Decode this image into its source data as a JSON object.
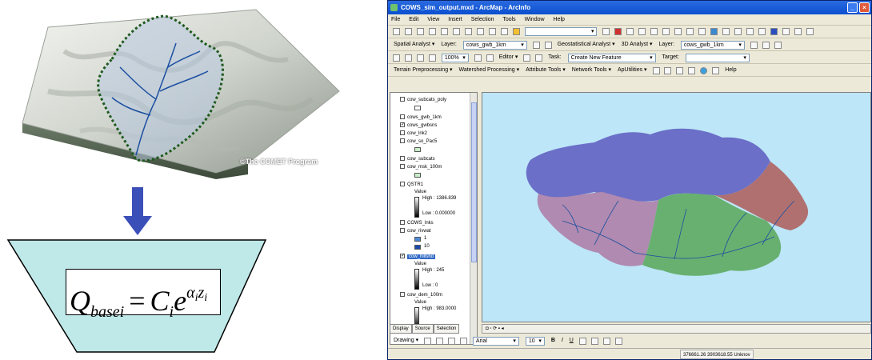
{
  "left_figure": {
    "credit": "©The COMET Program",
    "formula": {
      "q": "Q",
      "q_sub": "basei",
      "equals": "=",
      "c": "C",
      "c_sub": "i",
      "e": "e",
      "alpha": "α",
      "alpha_sub": "i",
      "z": "z",
      "z_sub": "i"
    },
    "colors": {
      "arrow": "#3b4fb8",
      "funnel": "#bfe8e8",
      "watershed_outline": "#1e5a1e",
      "stream": "#1b4fa0"
    }
  },
  "window": {
    "title": "COWS_sim_output.mxd - ArcMap - ArcInfo",
    "controls": [
      "_",
      "□",
      "×"
    ]
  },
  "menu": [
    "File",
    "Edit",
    "View",
    "Insert",
    "Selection",
    "Tools",
    "Window",
    "Help"
  ],
  "toolbar1": {
    "scale_value": ""
  },
  "toolbar2": {
    "spatial_analyst": "Spatial Analyst ▾",
    "layer_label": "Layer:",
    "layer_value": "cows_gwb_1km",
    "geostat": "Geostatistical Analyst ▾",
    "analyst3d": "3D Analyst ▾",
    "layer_label2": "Layer:",
    "layer_value2": "cows_gwb_1km"
  },
  "toolbar3": {
    "zoom_value": "100%",
    "editor": "Editor ▾",
    "task_label": "Task:",
    "task_value": "Create New Feature",
    "target_label": "Target:",
    "target_value": ""
  },
  "toolbar4": [
    "Terrain Preprocessing ▾",
    "Watershed Processing ▾",
    "Attribute Tools ▾",
    "Network Tools ▾",
    "ApUtilities ▾",
    "Help"
  ],
  "toc": {
    "layers": [
      {
        "name": "cow_subcats_poly",
        "checked": false
      },
      {
        "name": "cows_gwb_1km",
        "checked": false
      },
      {
        "name": "cows_gwbsns",
        "checked": true
      },
      {
        "name": "cow_lnk2",
        "checked": false
      },
      {
        "name": "cow_so_Pac5",
        "checked": false
      },
      {
        "name": "cow_subcats",
        "checked": false
      },
      {
        "name": "cow_msk_100m",
        "checked": false
      },
      {
        "name": "QSTR1",
        "checked": false
      },
      {
        "name": "COWS_lnks",
        "checked": false
      },
      {
        "name": "cow_rivwat",
        "checked": false
      },
      {
        "name": "cow_hillshd",
        "checked": true
      },
      {
        "name": "cow_dem_100m",
        "checked": false
      }
    ],
    "qstr_value": "Value",
    "qstr_high": "High : 1386.839",
    "qstr_low": "Low : 0.000000",
    "rivwat_1": "1",
    "rivwat_10": "10",
    "hill_value": "Value",
    "hill_high": "High : 245",
    "hill_low": "Low : 0",
    "dem_value": "Value",
    "dem_high": "High : 983.0000"
  },
  "toc_tabs": [
    "Display",
    "Source",
    "Selection"
  ],
  "drawing": {
    "label": "Drawing ▾",
    "font": "Arial",
    "size": "10",
    "bold": "B",
    "italic": "I",
    "underline": "U"
  },
  "status": {
    "coordinates": "376661.26  3903618.55 Unknov"
  },
  "map_colors": {
    "background": "#bde6f8",
    "blue_region": "#6b6fc8",
    "green_region": "#68b070",
    "red_region": "#b07070",
    "pink_region": "#b08ab0",
    "streams": "#1b4fa0"
  }
}
